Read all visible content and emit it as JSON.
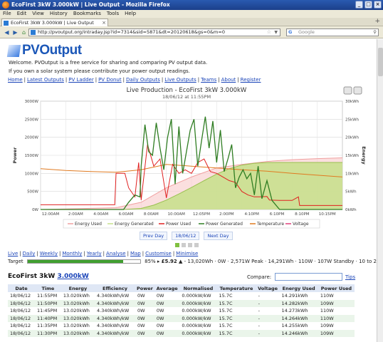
{
  "window": {
    "title": "EcoFirst 3kW 3.000kW | Live Output - Mozilla Firefox"
  },
  "menu": [
    "File",
    "Edit",
    "View",
    "History",
    "Bookmarks",
    "Tools",
    "Help"
  ],
  "tab": {
    "label": "EcoFirst 3kW 3.000kW | Live Output"
  },
  "address": {
    "url": "http://pvoutput.org/intraday.jsp?id=7314&sid=5871&dt=20120618&gs=0&m=0"
  },
  "search": {
    "placeholder": "Google"
  },
  "page": {
    "logo": "PVOutput",
    "intro1": "Welcome. PVOutput is a free service for sharing and comparing PV output data.",
    "intro2": "If you own a solar system please contribute your power output readings.",
    "nav": [
      "Home",
      "Latest Outputs",
      "PV Ladder",
      "PV Donut",
      "Daily Outputs",
      "Live Outputs",
      "Teams",
      "About",
      "Register"
    ],
    "views": [
      "Live",
      "Daily",
      "Weekly",
      "Monthly",
      "Yearly",
      "Analyse",
      "Map",
      "Customise",
      "Minimise"
    ],
    "date_nav": {
      "prev": "Prev Day",
      "current": "18/06/12",
      "next": "Next Day"
    },
    "target": {
      "label": "Target",
      "fraction": 0.85,
      "summary_a": "85% ▸ ",
      "value": "£5.92",
      "summary_b": " ▲ - 13,020Wh · 0W · 2,571W Peak · 14,291Wh · 110W · 107W Standby · 10 to 20C"
    },
    "system": {
      "name": "EcoFirst 3kW",
      "size": "3.000kW"
    },
    "compare_label": "Compare:",
    "tips": "Tips"
  },
  "chart_data": {
    "type": "line",
    "title": "Live Production - EcoFirst 3kW 3.000kW",
    "subtitle": "18/06/12 at 11:55PM",
    "ylabel": "Power",
    "y2label": "Energy",
    "ylim": [
      0,
      3000
    ],
    "y2lim": [
      0,
      30
    ],
    "y_ticks": [
      "0W",
      "500W",
      "1000W",
      "1500W",
      "2000W",
      "2500W",
      "3000W"
    ],
    "y2_ticks": [
      "0kWh",
      "5kWh",
      "10kWh",
      "15kWh",
      "20kWh",
      "25kWh",
      "30kWh"
    ],
    "x_ticks": [
      "12:00AM",
      "2:00AM",
      "4:00AM",
      "6:00AM",
      "8:00AM",
      "10:00AM",
      "12:05PM",
      "2:00PM",
      "4:10PM",
      "6:10PM",
      "8:10PM",
      "10:15PM"
    ],
    "grid": true,
    "legend_position": "bottom",
    "series": [
      {
        "name": "Energy Used",
        "color": "#f0a0a0",
        "x": [
          0,
          6,
          8,
          10,
          12,
          14,
          16,
          18,
          20,
          22,
          24
        ],
        "y": [
          0,
          0.5,
          2,
          6,
          9,
          11.5,
          12.5,
          13.3,
          13.8,
          14.1,
          14.3
        ]
      },
      {
        "name": "Energy Generated",
        "color": "#c6e08a",
        "x": [
          0,
          6.6,
          8,
          9,
          10,
          11,
          12,
          13,
          14,
          15,
          16,
          17,
          18,
          19,
          24
        ],
        "y": [
          0,
          0,
          0.3,
          1.2,
          2.6,
          4.3,
          6.1,
          8.0,
          9.8,
          11.3,
          12.3,
          12.8,
          13.0,
          13.02,
          13.02
        ]
      },
      {
        "name": "Power Used",
        "color": "#e02020",
        "x": [
          0,
          5.9,
          6.0,
          6.7,
          7.0,
          7.5,
          7.8,
          8.0,
          8.5,
          9.0,
          9.5,
          10.0,
          10.5,
          11.0,
          11.5,
          12.0,
          12.5,
          13.0,
          13.5,
          14.0,
          14.5,
          15.0,
          15.5,
          16.0,
          16.5,
          17.0,
          17.5,
          18.0,
          18.2,
          19.0,
          20.0,
          20.5,
          20.6,
          22.0,
          24.0
        ],
        "y": [
          130,
          130,
          1000,
          1000,
          600,
          350,
          1300,
          260,
          1800,
          1200,
          1400,
          320,
          1250,
          1000,
          1100,
          1000,
          1300,
          1400,
          1050,
          1000,
          900,
          800,
          750,
          500,
          400,
          350,
          350,
          360,
          260,
          250,
          250,
          350,
          110,
          110,
          110
        ]
      },
      {
        "name": "Power Generated",
        "color": "#2f7d22",
        "x": [
          0,
          6.6,
          7.0,
          7.5,
          7.9,
          8.0,
          8.3,
          8.6,
          8.9,
          9.2,
          9.5,
          9.8,
          10.1,
          10.4,
          10.7,
          11.0,
          11.3,
          11.6,
          11.9,
          12.2,
          12.5,
          12.8,
          13.1,
          13.4,
          13.7,
          14.0,
          14.3,
          14.6,
          14.9,
          15.2,
          15.5,
          15.8,
          16.1,
          16.4,
          16.7,
          17.0,
          17.3,
          17.6,
          18.0,
          18.4,
          19.0,
          24.0
        ],
        "y": [
          0,
          0,
          200,
          400,
          350,
          1200,
          2350,
          1600,
          1500,
          2400,
          1700,
          1100,
          2000,
          2500,
          700,
          2300,
          1000,
          1600,
          2200,
          2500,
          1200,
          1900,
          2571,
          1700,
          2450,
          1300,
          2200,
          1050,
          1400,
          1800,
          600,
          900,
          1100,
          850,
          1000,
          400,
          1200,
          300,
          800,
          250,
          0,
          0
        ]
      },
      {
        "name": "Temperature",
        "color": "#e07a20",
        "x": [
          0,
          2,
          4,
          6,
          8,
          10,
          12,
          14,
          16,
          18,
          20,
          22,
          24
        ],
        "y": [
          1130,
          1080,
          1050,
          1030,
          1100,
          1250,
          1200,
          1150,
          1100,
          1060,
          1000,
          950,
          900
        ]
      },
      {
        "name": "Voltage",
        "color": "#e0407a",
        "x": [],
        "y": []
      }
    ]
  },
  "table": {
    "headers": [
      "Date",
      "Time",
      "Energy",
      "Efficiency",
      "Power",
      "Average",
      "Normalised",
      "Temperature",
      "Voltage",
      "Energy Used",
      "Power Used"
    ],
    "rows": [
      [
        "18/06/12",
        "11:55PM",
        "13.020kWh",
        "4.340kWh/kW",
        "0W",
        "0W",
        "0.000kW/kW",
        "15.7C",
        "-",
        "14.291kWh",
        "110W"
      ],
      [
        "18/06/12",
        "11:50PM",
        "13.020kWh",
        "4.340kWh/kW",
        "0W",
        "0W",
        "0.000kW/kW",
        "15.7C",
        "-",
        "14.282kWh",
        "109W"
      ],
      [
        "18/06/12",
        "11:45PM",
        "13.020kWh",
        "4.340kWh/kW",
        "0W",
        "0W",
        "0.000kW/kW",
        "15.7C",
        "-",
        "14.273kWh",
        "110W"
      ],
      [
        "18/06/12",
        "11:40PM",
        "13.020kWh",
        "4.340kWh/kW",
        "0W",
        "0W",
        "0.000kW/kW",
        "15.7C",
        "-",
        "14.264kWh",
        "110W"
      ],
      [
        "18/06/12",
        "11:35PM",
        "13.020kWh",
        "4.340kWh/kW",
        "0W",
        "0W",
        "0.000kW/kW",
        "15.7C",
        "-",
        "14.255kWh",
        "109W"
      ],
      [
        "18/06/12",
        "11:30PM",
        "13.020kWh",
        "4.340kWh/kW",
        "0W",
        "0W",
        "0.000kW/kW",
        "15.7C",
        "-",
        "14.246kWh",
        "109W"
      ]
    ]
  }
}
